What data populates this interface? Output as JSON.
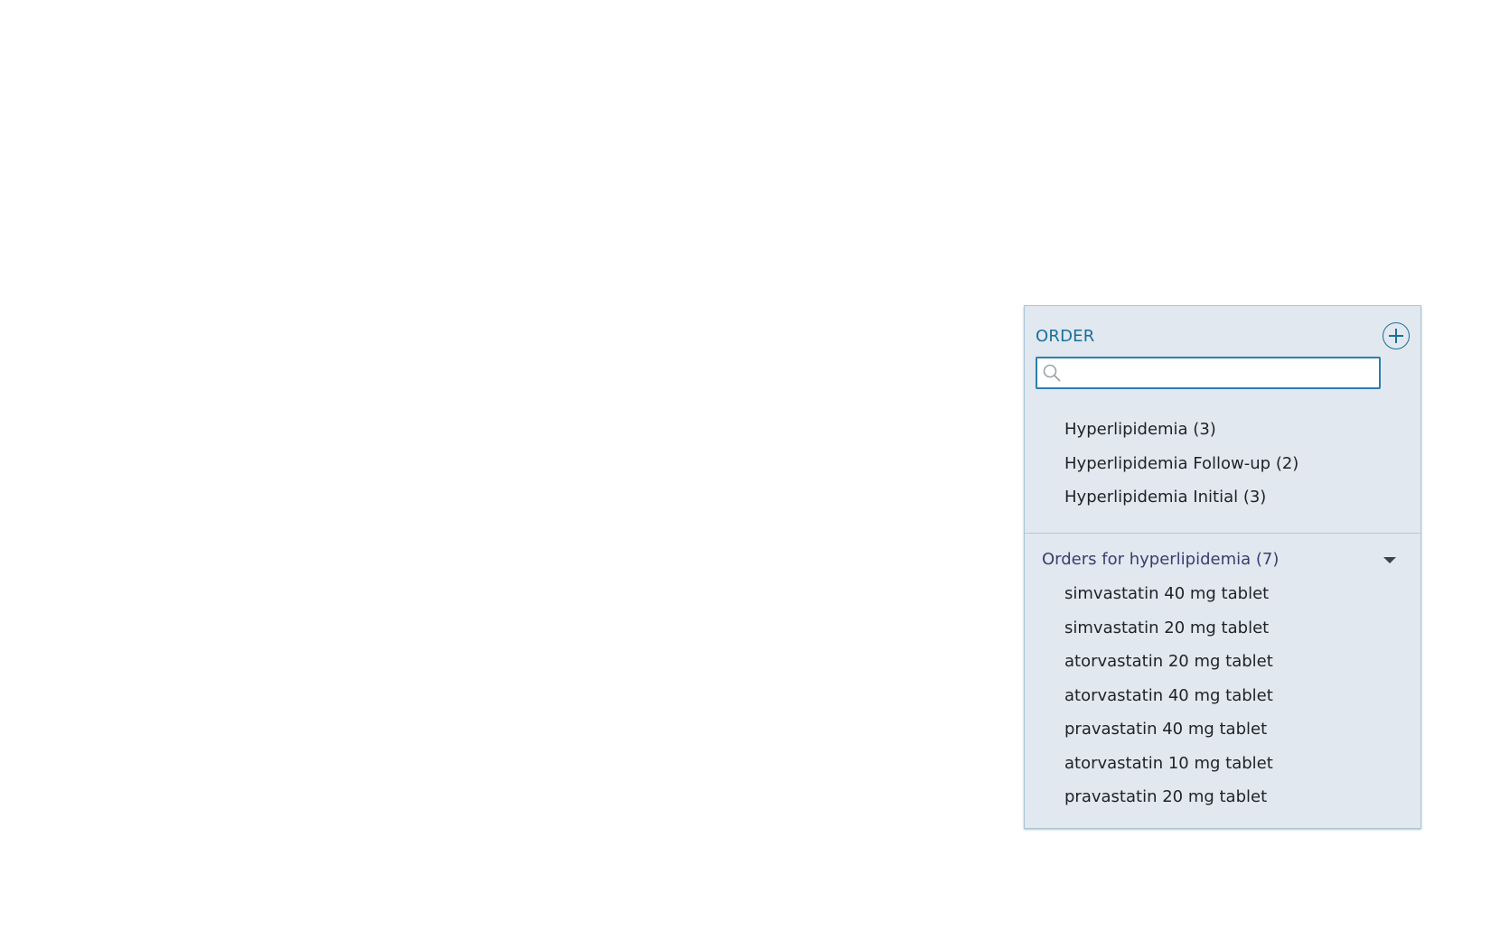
{
  "panel": {
    "title": "ORDER",
    "search": {
      "value": "",
      "placeholder": ""
    },
    "suggestions": [
      {
        "label": "Hyperlipidemia (3)"
      },
      {
        "label": "Hyperlipidemia Follow-up (2)"
      },
      {
        "label": "Hyperlipidemia Initial (3)"
      }
    ],
    "group": {
      "title": "Orders for hyperlipidemia (7)",
      "items": [
        {
          "label": "simvastatin 40 mg tablet"
        },
        {
          "label": "simvastatin 20 mg tablet"
        },
        {
          "label": "atorvastatin 20 mg tablet"
        },
        {
          "label": "atorvastatin 40 mg tablet"
        },
        {
          "label": "pravastatin 40 mg tablet"
        },
        {
          "label": "atorvastatin 10 mg tablet"
        },
        {
          "label": "pravastatin 20 mg tablet"
        }
      ]
    }
  },
  "icons": {
    "add": "plus-circle-icon",
    "search": "search-icon",
    "collapse": "chevron-down-icon"
  },
  "colors": {
    "accent": "#1b6f99",
    "panel_background": "#e1e8ef",
    "group_title": "#3a3e6e"
  }
}
